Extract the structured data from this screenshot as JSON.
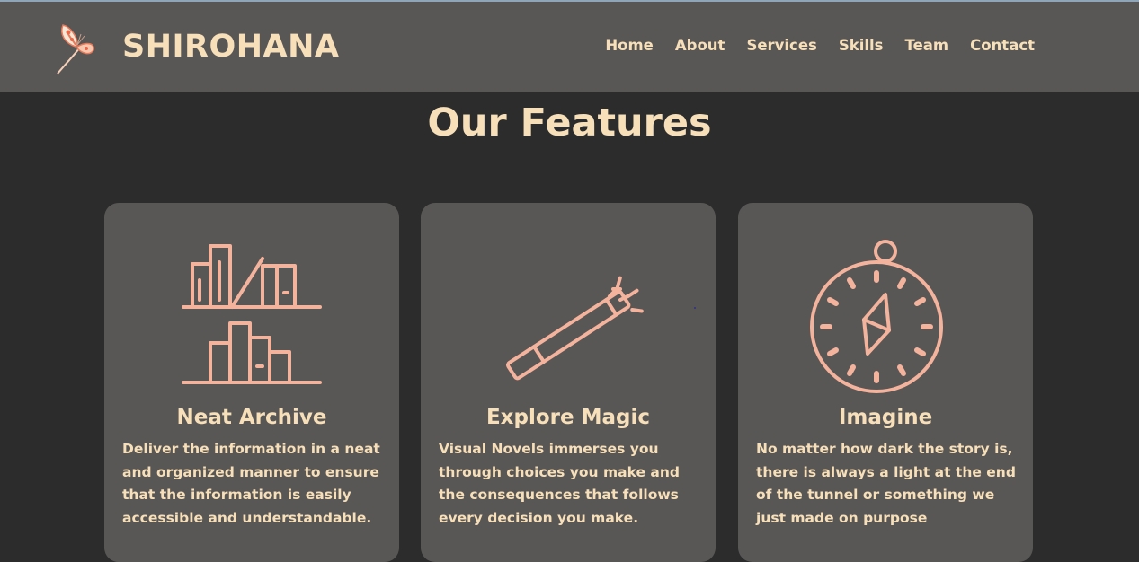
{
  "header": {
    "brand": "SHIROHANA",
    "nav": [
      "Home",
      "About",
      "Services",
      "Skills",
      "Team",
      "Contact"
    ]
  },
  "features": {
    "title": "Our Features",
    "cards": [
      {
        "icon": "bookshelf-icon",
        "title": "Neat Archive",
        "description": "Deliver the information in a neat and organized manner to ensure that the information is easily accessible and understandable."
      },
      {
        "icon": "magic-wand-icon",
        "title": "Explore Magic",
        "description": "Visual Novels immerses you through choices you make and the consequences that follows every decision you make."
      },
      {
        "icon": "compass-icon",
        "title": "Imagine",
        "description": "No matter how dark the story is, there is always a light at the end of the tunnel or something we just made on purpose"
      }
    ]
  },
  "colors": {
    "background": "#2c2c2c",
    "panel": "#595756",
    "text": "#f6dfb9",
    "icon_stroke": "#f4b39c"
  }
}
